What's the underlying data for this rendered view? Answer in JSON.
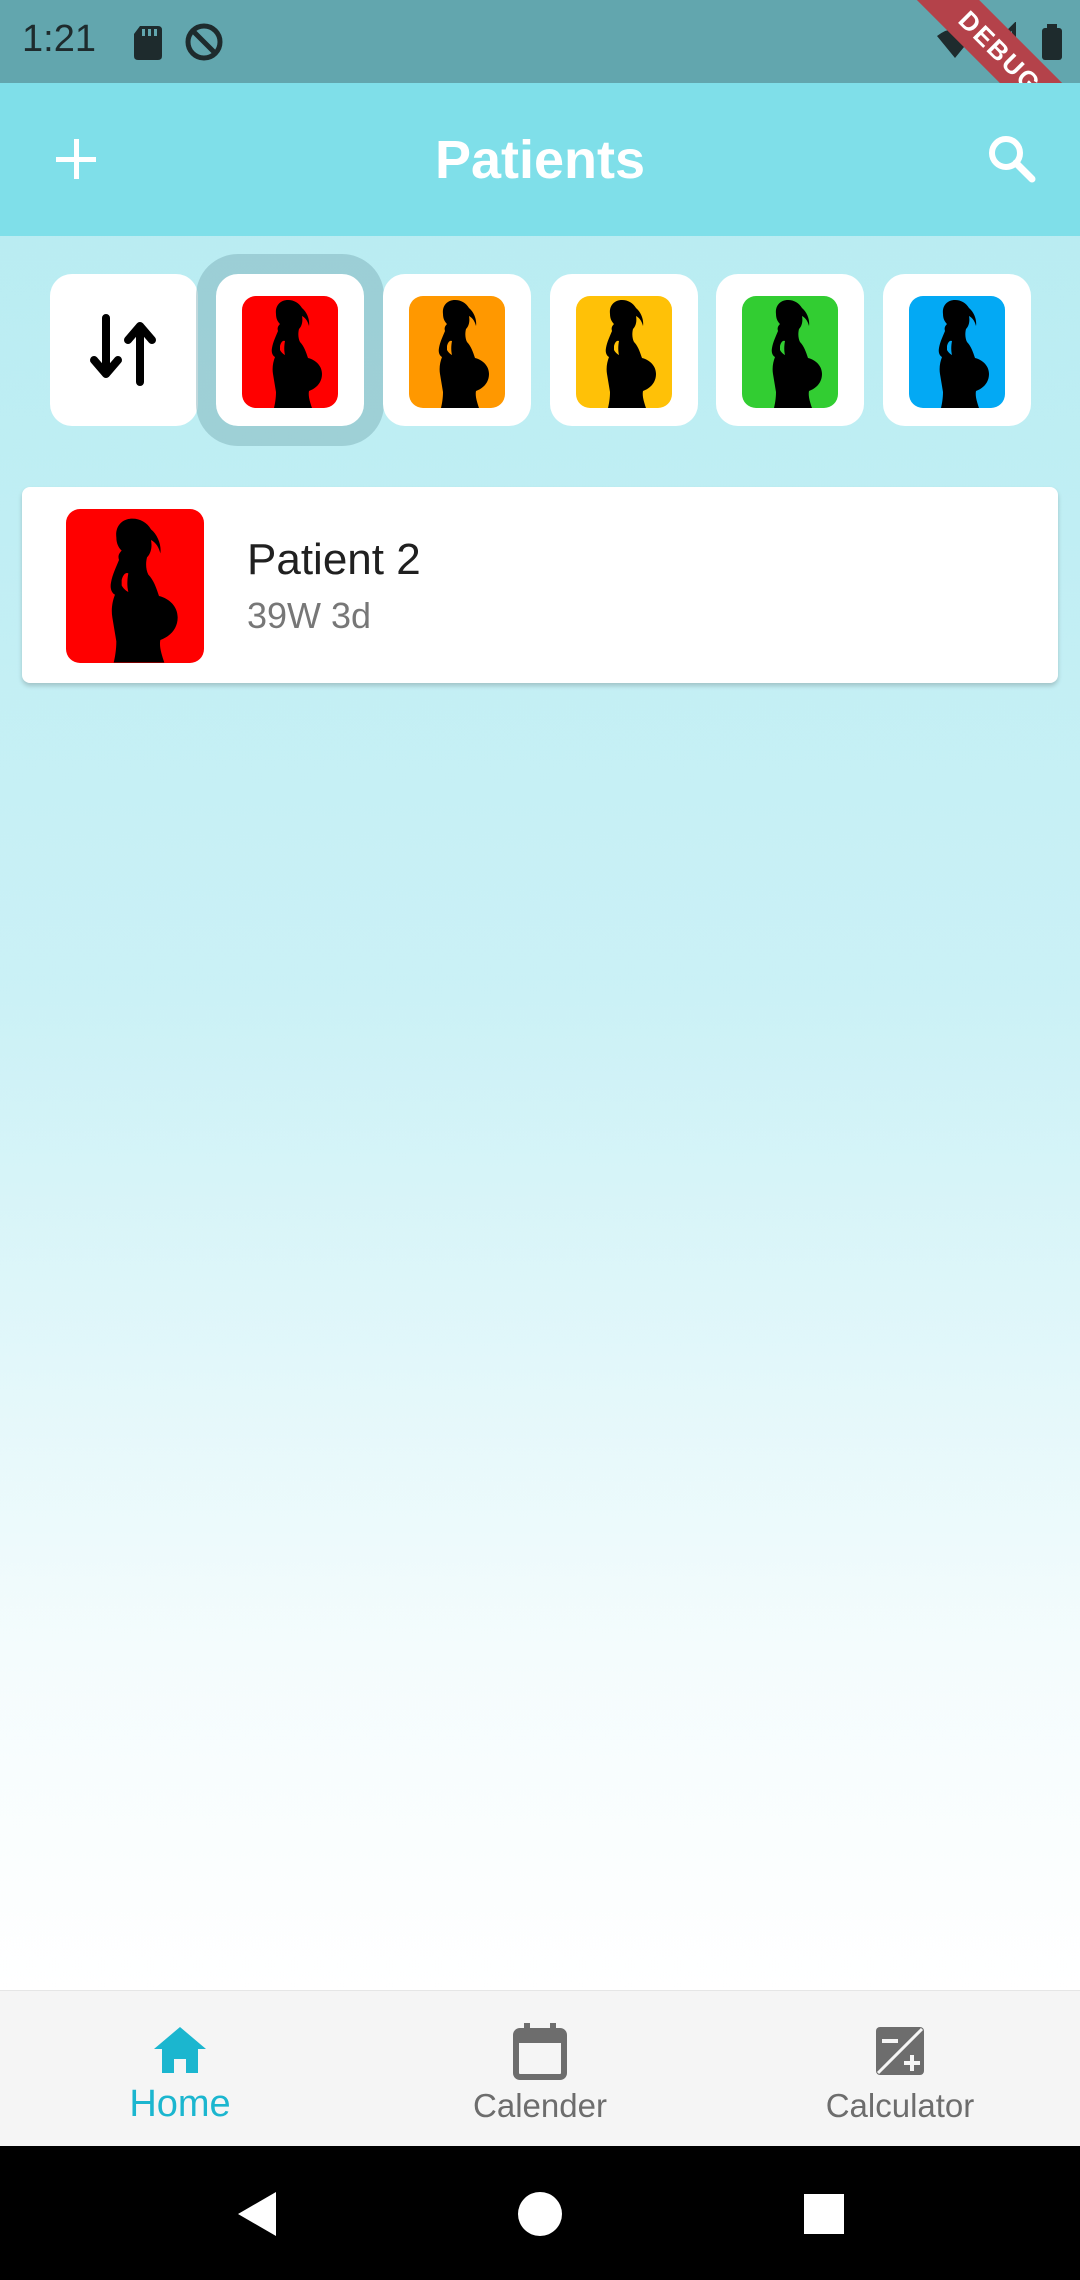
{
  "status_bar": {
    "time": "1:21",
    "icons": [
      "sd-card-icon",
      "do-not-disturb-icon",
      "wifi-icon",
      "signal-icon",
      "battery-icon"
    ],
    "debug_label": "DEBUG",
    "bg_color": "#62a6ae"
  },
  "app_bar": {
    "title": "Patients",
    "left_icon": "add-icon",
    "right_icon": "search-icon",
    "bg_color": "#7fdfe9"
  },
  "filters": {
    "sort_icon": "sort-arrows-icon",
    "chips": [
      {
        "name": "red",
        "color": "#ff0000",
        "selected": true
      },
      {
        "name": "orange",
        "color": "#ff9800",
        "selected": false
      },
      {
        "name": "yellow",
        "color": "#ffc107",
        "selected": false
      },
      {
        "name": "green",
        "color": "#32cd32",
        "selected": false
      },
      {
        "name": "blue",
        "color": "#03a9f4",
        "selected": false
      }
    ]
  },
  "patients": [
    {
      "name": "Patient 2",
      "gestation": "39W 3d",
      "color": "#ff0000"
    }
  ],
  "bottom_nav": {
    "items": [
      {
        "label": "Home",
        "icon": "home-icon",
        "active": true
      },
      {
        "label": "Calender",
        "icon": "calendar-icon",
        "active": false
      },
      {
        "label": "Calculator",
        "icon": "calculator-icon",
        "active": false
      }
    ],
    "active_color": "#1bb6cf"
  },
  "system_nav": {
    "icons": [
      "back-icon",
      "home-circle-icon",
      "recents-icon"
    ]
  }
}
